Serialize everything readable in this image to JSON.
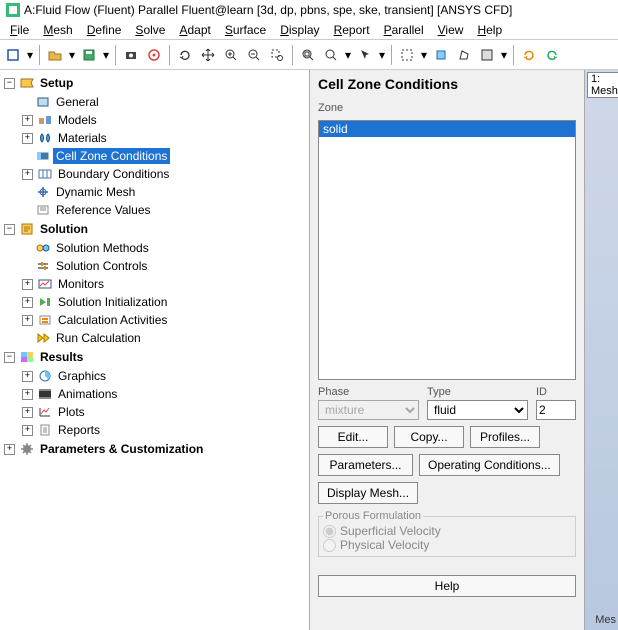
{
  "title": "A:Fluid Flow (Fluent) Parallel Fluent@learn  [3d, dp, pbns, spe, ske, transient] [ANSYS CFD]",
  "menus": [
    "File",
    "Mesh",
    "Define",
    "Solve",
    "Adapt",
    "Surface",
    "Display",
    "Report",
    "Parallel",
    "View",
    "Help"
  ],
  "tree": {
    "setup": {
      "label": "Setup",
      "items": [
        {
          "label": "General",
          "ic": "gen"
        },
        {
          "label": "Models",
          "ic": "mod",
          "exp": true
        },
        {
          "label": "Materials",
          "ic": "mat",
          "exp": true
        },
        {
          "label": "Cell Zone Conditions",
          "ic": "czc",
          "sel": true
        },
        {
          "label": "Boundary Conditions",
          "ic": "bc",
          "exp": true
        },
        {
          "label": "Dynamic Mesh",
          "ic": "dm"
        },
        {
          "label": "Reference Values",
          "ic": "rv"
        }
      ]
    },
    "solution": {
      "label": "Solution",
      "items": [
        {
          "label": "Solution Methods",
          "ic": "sm"
        },
        {
          "label": "Solution Controls",
          "ic": "sc"
        },
        {
          "label": "Monitors",
          "ic": "mn",
          "exp": true
        },
        {
          "label": "Solution Initialization",
          "ic": "si",
          "exp": true
        },
        {
          "label": "Calculation Activities",
          "ic": "ca",
          "exp": true
        },
        {
          "label": "Run Calculation",
          "ic": "rc"
        }
      ]
    },
    "results": {
      "label": "Results",
      "items": [
        {
          "label": "Graphics",
          "ic": "gr",
          "exp": true
        },
        {
          "label": "Animations",
          "ic": "an",
          "exp": true
        },
        {
          "label": "Plots",
          "ic": "pl",
          "exp": true
        },
        {
          "label": "Reports",
          "ic": "rp",
          "exp": true
        }
      ]
    },
    "params": {
      "label": "Parameters & Customization"
    }
  },
  "panel": {
    "title": "Cell Zone Conditions",
    "zone_label": "Zone",
    "zone_items": [
      "solid"
    ],
    "phase_label": "Phase",
    "phase_value": "mixture",
    "type_label": "Type",
    "type_value": "fluid",
    "id_label": "ID",
    "id_value": "2",
    "btn_edit": "Edit...",
    "btn_copy": "Copy...",
    "btn_profiles": "Profiles...",
    "btn_params": "Parameters...",
    "btn_opcond": "Operating Conditions...",
    "btn_dispmesh": "Display Mesh...",
    "porous_legend": "Porous Formulation",
    "porous_superficial": "Superficial Velocity",
    "porous_physical": "Physical Velocity",
    "btn_help": "Help"
  },
  "canvas": {
    "tab": "1: Mesh",
    "corner": "Mes"
  }
}
